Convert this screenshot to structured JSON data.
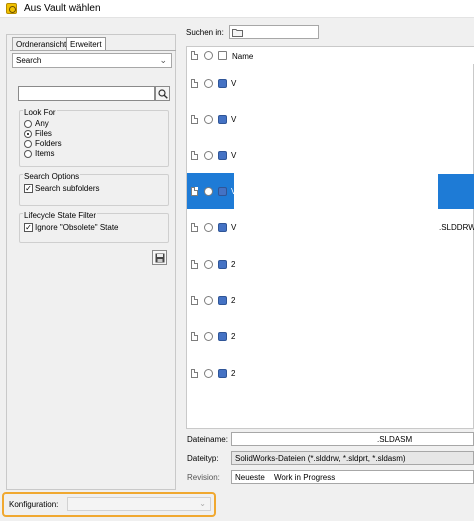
{
  "window": {
    "title": "Aus Vault wählen"
  },
  "tabs": [
    {
      "label": "Ordneransicht"
    },
    {
      "label": "Erweitert"
    }
  ],
  "search_mode": {
    "selected": "Search"
  },
  "search": {
    "value": ""
  },
  "look_for": {
    "title": "Look For",
    "options": [
      {
        "label": "Any",
        "selected": false
      },
      {
        "label": "Files",
        "selected": true
      },
      {
        "label": "Folders",
        "selected": false
      },
      {
        "label": "Items",
        "selected": false
      }
    ]
  },
  "search_options": {
    "title": "Search Options",
    "subfolders": {
      "label": "Search subfolders",
      "checked": true
    }
  },
  "lifecycle": {
    "title": "Lifecycle State Filter",
    "ignore_obsolete": {
      "label": "Ignore \"Obsolete\" State",
      "checked": true
    }
  },
  "search_in": {
    "label": "Suchen in:",
    "value": ""
  },
  "list": {
    "columns": {
      "name": "Name"
    },
    "rows": [
      {
        "name": "V",
        "selected": false,
        "ext": ""
      },
      {
        "name": "V",
        "selected": false,
        "ext": ""
      },
      {
        "name": "V",
        "selected": false,
        "ext": ""
      },
      {
        "name": "V",
        "selected": true,
        "ext": ""
      },
      {
        "name": "V",
        "selected": false,
        "ext": ".SLDDRW"
      },
      {
        "name": "2",
        "selected": false,
        "ext": ""
      },
      {
        "name": "2",
        "selected": false,
        "ext": ""
      },
      {
        "name": "2",
        "selected": false,
        "ext": ""
      },
      {
        "name": "2",
        "selected": false,
        "ext": ""
      }
    ],
    "selection_color": "#1e7bd6"
  },
  "fields": {
    "filename": {
      "label": "Dateiname:",
      "value": ".SLDASM"
    },
    "filetype": {
      "label": "Dateityp:",
      "value": "SolidWorks-Dateien (*.slddrw, *.sldprt, *.sldasm)"
    },
    "revision": {
      "label": "Revision:",
      "value": "Neueste",
      "value2": "Work in Progress"
    }
  },
  "configuration": {
    "label": "Konfiguration:",
    "value": "",
    "highlight_color": "#f0a830"
  }
}
